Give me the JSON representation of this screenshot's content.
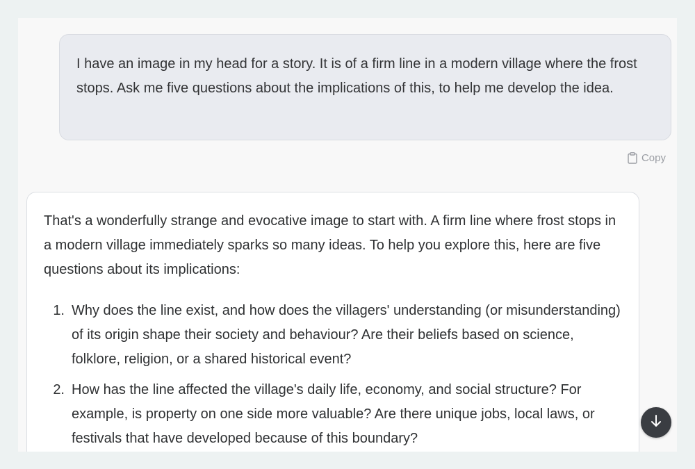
{
  "user_message": {
    "text": "I have an image in my head for a story. It is of a firm line in a modern village where the frost stops. Ask me five questions about the implications of this, to help me develop the idea."
  },
  "copy_action": {
    "label": "Copy",
    "icon": "clipboard-icon"
  },
  "assistant_message": {
    "intro": "That's a wonderfully strange and evocative image to start with. A firm line where frost stops in a modern village immediately sparks so many ideas. To help you explore this, here are five questions about its implications:",
    "questions": [
      {
        "number": "1.",
        "text": "Why does the line exist, and how does the villagers' understanding (or misunderstanding) of its origin shape their society and behaviour? Are their beliefs based on science, folklore, religion, or a shared historical event?"
      },
      {
        "number": "2.",
        "text": "How has the line affected the village's daily life, economy, and social structure? For example, is property on one side more valuable? Are there unique jobs, local laws, or festivals that have developed because of this boundary?"
      }
    ]
  },
  "scroll_button": {
    "icon": "arrow-down-icon"
  },
  "colors": {
    "page_background": "#edf2f2",
    "panel_background": "#f8f8f8",
    "user_bubble": "#e9ebf0",
    "assistant_card": "#ffffff",
    "scroll_button": "#3a3d42"
  }
}
